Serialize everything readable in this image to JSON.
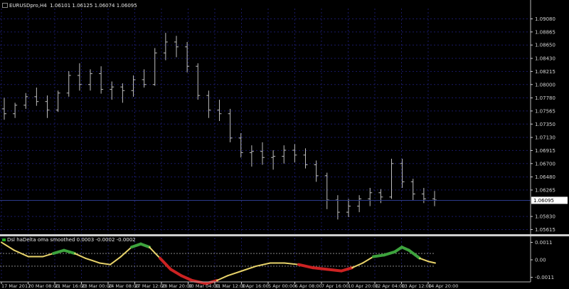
{
  "window": {
    "symbol_header": "EURUSDpro,H4",
    "ohlc": "1.06101 1.06125 1.06074 1.06095"
  },
  "indicator": {
    "title": "Dsl haDelta oma smoothed",
    "values": "0.0003 -0.0002 -0.0002"
  },
  "main_axis": {
    "ticks": [
      "1.09080",
      "1.08865",
      "1.08650",
      "1.08430",
      "1.08215",
      "1.08000",
      "1.07780",
      "1.07565",
      "1.07350",
      "1.07130",
      "1.06915",
      "1.06700",
      "1.06480",
      "1.06265",
      "1.05830",
      "1.05615"
    ],
    "current_price": "1.06095"
  },
  "sub_axis": {
    "ticks": [
      "0.0011",
      "0.00",
      "-0.0011"
    ]
  },
  "time_axis": {
    "labels": [
      "17 Mar 2017",
      "20 Mar 08:00",
      "21 Mar 16:00",
      "23 Mar 00:00",
      "24 Mar 08:00",
      "27 Mar 12:00",
      "28 Mar 20:00",
      "30 Mar 04:00",
      "31 Mar 12:00",
      "3 Apr 16:00",
      "5 Apr 00:00",
      "6 Apr 08:00",
      "7 Apr 16:00",
      "10 Apr 20:00",
      "12 Apr 04:00",
      "13 Apr 12:00",
      "14 Apr 20:00"
    ]
  },
  "chart_data": {
    "type": "bar",
    "series": [
      {
        "values": [
          [
            1.076,
            1.0778,
            1.0742,
            1.0752
          ],
          [
            1.0752,
            1.077,
            1.0745,
            1.0766
          ],
          [
            1.0766,
            1.0786,
            1.076,
            1.078
          ],
          [
            1.078,
            1.0795,
            1.0765,
            1.0772
          ],
          [
            1.0772,
            1.0782,
            1.0745,
            1.0758
          ],
          [
            1.0758,
            1.079,
            1.0755,
            1.0786
          ],
          [
            1.0786,
            1.0822,
            1.078,
            1.0815
          ],
          [
            1.0815,
            1.0835,
            1.079,
            1.08
          ],
          [
            1.08,
            1.0825,
            1.079,
            1.0818
          ],
          [
            1.0818,
            1.083,
            1.0785,
            1.0792
          ],
          [
            1.0792,
            1.0805,
            1.0775,
            1.0796
          ],
          [
            1.0796,
            1.0802,
            1.077,
            1.079
          ],
          [
            1.079,
            1.0815,
            1.078,
            1.0808
          ],
          [
            1.0808,
            1.0825,
            1.0795,
            1.08
          ],
          [
            1.08,
            1.086,
            1.0798,
            1.0852
          ],
          [
            1.0852,
            1.0885,
            1.084,
            1.087
          ],
          [
            1.087,
            1.088,
            1.0845,
            1.0862
          ],
          [
            1.0862,
            1.087,
            1.082,
            1.083
          ],
          [
            1.083,
            1.0835,
            1.0775,
            1.0782
          ],
          [
            1.0782,
            1.079,
            1.0745,
            1.0758
          ],
          [
            1.0758,
            1.0775,
            1.074,
            1.0752
          ],
          [
            1.0752,
            1.076,
            1.0705,
            1.0712
          ],
          [
            1.0712,
            1.072,
            1.068,
            1.0688
          ],
          [
            1.0688,
            1.07,
            1.0665,
            1.069
          ],
          [
            1.069,
            1.0705,
            1.0668,
            1.068
          ],
          [
            1.068,
            1.0692,
            1.066,
            1.0682
          ],
          [
            1.0682,
            1.07,
            1.067,
            1.0692
          ],
          [
            1.0692,
            1.0702,
            1.0672,
            1.0684
          ],
          [
            1.0684,
            1.0695,
            1.0662,
            1.0668
          ],
          [
            1.0668,
            1.0675,
            1.064,
            1.065
          ],
          [
            1.065,
            1.0655,
            1.0595,
            1.061
          ],
          [
            1.061,
            1.0618,
            1.0578,
            1.059
          ],
          [
            1.059,
            1.0612,
            1.0582,
            1.06
          ],
          [
            1.06,
            1.0618,
            1.059,
            1.0612
          ],
          [
            1.0612,
            1.063,
            1.06,
            1.0622
          ],
          [
            1.0622,
            1.0628,
            1.0605,
            1.0615
          ],
          [
            1.0615,
            1.0678,
            1.0612,
            1.067
          ],
          [
            1.067,
            1.0678,
            1.063,
            1.064
          ],
          [
            1.064,
            1.0645,
            1.061,
            1.062
          ],
          [
            1.062,
            1.063,
            1.0605,
            1.0612
          ],
          [
            1.0612,
            1.0625,
            1.06,
            1.061
          ]
        ]
      }
    ],
    "ylim": [
      1.0555,
      1.0925
    ]
  },
  "colors": {
    "background": "#000000",
    "grid": "#1a1a66",
    "bars": "#bdbdbd",
    "axis_text": "#d2d2d2",
    "current_price_box": "#ffffff",
    "osc_neutral": "#e8d36a",
    "osc_up": "#3da33d",
    "osc_down": "#cc2222",
    "level_lines": "#9a9a9a"
  }
}
